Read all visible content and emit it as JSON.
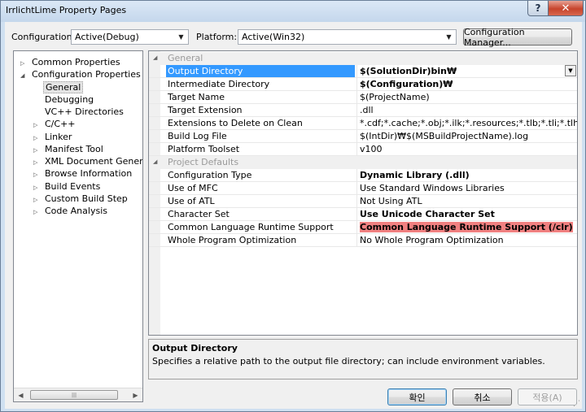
{
  "window": {
    "title": "IrrlichtLime Property Pages"
  },
  "titlebar": {
    "help_glyph": "?",
    "close_glyph": "✕"
  },
  "config_bar": {
    "configuration_label": "Configuration:",
    "configuration_value": "Active(Debug)",
    "platform_label": "Platform:",
    "platform_value": "Active(Win32)",
    "manager_button": "Configuration Manager..."
  },
  "tree": {
    "items": [
      {
        "label": "Common Properties",
        "expander": "▷"
      },
      {
        "label": "Configuration Properties",
        "expander": "◢"
      },
      {
        "label": "General",
        "expander": ""
      },
      {
        "label": "Debugging",
        "expander": ""
      },
      {
        "label": "VC++ Directories",
        "expander": ""
      },
      {
        "label": "C/C++",
        "expander": "▷"
      },
      {
        "label": "Linker",
        "expander": "▷"
      },
      {
        "label": "Manifest Tool",
        "expander": "▷"
      },
      {
        "label": "XML Document Generator",
        "expander": "▷"
      },
      {
        "label": "Browse Information",
        "expander": "▷"
      },
      {
        "label": "Build Events",
        "expander": "▷"
      },
      {
        "label": "Custom Build Step",
        "expander": "▷"
      },
      {
        "label": "Code Analysis",
        "expander": "▷"
      }
    ],
    "scroll_grip": "|||"
  },
  "grid": {
    "category_expander": "◢",
    "categories": [
      {
        "name": "General",
        "rows": [
          {
            "name": "Output Directory",
            "value": "$(SolutionDir)bin₩"
          },
          {
            "name": "Intermediate Directory",
            "value": "$(Configuration)₩"
          },
          {
            "name": "Target Name",
            "value": "$(ProjectName)"
          },
          {
            "name": "Target Extension",
            "value": ".dll"
          },
          {
            "name": "Extensions to Delete on Clean",
            "value": "*.cdf;*.cache;*.obj;*.ilk;*.resources;*.tlb;*.tli;*.tlh;*.tmp;*.rsp;*"
          },
          {
            "name": "Build Log File",
            "value": "$(IntDir)₩$(MSBuildProjectName).log"
          },
          {
            "name": "Platform Toolset",
            "value": "v100"
          }
        ]
      },
      {
        "name": "Project Defaults",
        "rows": [
          {
            "name": "Configuration Type",
            "value": "Dynamic Library (.dll)"
          },
          {
            "name": "Use of MFC",
            "value": "Use Standard Windows Libraries"
          },
          {
            "name": "Use of ATL",
            "value": "Not Using ATL"
          },
          {
            "name": "Character Set",
            "value": "Use Unicode Character Set"
          },
          {
            "name": "Common Language Runtime Support",
            "value": "Common Language Runtime Support (/clr)"
          },
          {
            "name": "Whole Program Optimization",
            "value": "No Whole Program Optimization"
          }
        ]
      }
    ]
  },
  "description": {
    "title": "Output Directory",
    "text": "Specifies a relative path to the output file directory; can include environment variables."
  },
  "buttons": {
    "ok": "확인",
    "cancel": "취소",
    "apply": "적용(A)"
  },
  "colors": {
    "selection": "#3399ff",
    "highlight": "#f08080",
    "close_button": "#c7442c"
  }
}
